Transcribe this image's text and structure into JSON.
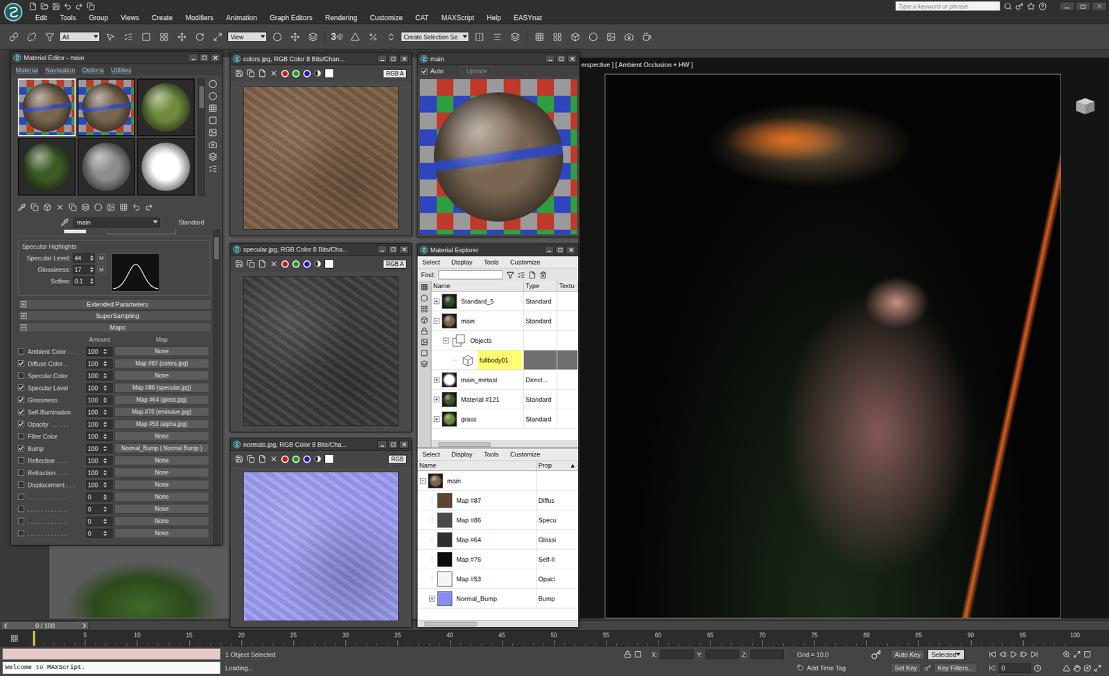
{
  "app": {
    "menu": [
      "Edit",
      "Tools",
      "Group",
      "Views",
      "Create",
      "Modifiers",
      "Animation",
      "Graph Editors",
      "Rendering",
      "Customize",
      "CAT",
      "MAXScript",
      "Help",
      "EASYnat"
    ],
    "search": {
      "placeholder": "Type a keyword or phrase"
    }
  },
  "toolbar": {
    "selection_filter": "All",
    "reference_coordinate_system": "View",
    "snap_toggle": "3",
    "named_selection_set": "Create Selection Se"
  },
  "viewport": {
    "label": "erspective ] [ Ambient Occlusion + HW ]"
  },
  "material_editor": {
    "title": "Material Editor - main",
    "menu": [
      "Material",
      "Navigation",
      "Options",
      "Utilities"
    ],
    "slots": [
      {
        "color": "#7a6650",
        "checker": true,
        "selected": true
      },
      {
        "color": "#7a6650",
        "checker": true,
        "selected": false
      },
      {
        "color": "#6f8a3c",
        "checker": false,
        "selected": false
      },
      {
        "color": "#3d5a26",
        "checker": false,
        "selected": false
      },
      {
        "color": "#8c8c8c",
        "checker": false,
        "selected": false
      },
      {
        "color": "#ffffff",
        "checker": false,
        "selected": false
      }
    ],
    "material_name": "main",
    "material_type": "Standard",
    "specular_highlights": {
      "title": "Specular Highlights",
      "params": [
        {
          "label": "Specular Level:",
          "value": "44",
          "map_button": "M"
        },
        {
          "label": "Glossiness:",
          "value": "17",
          "map_button": "M"
        },
        {
          "label": "Soften:",
          "value": "0.1"
        }
      ]
    },
    "rollouts": [
      {
        "label": "Extended Parameters",
        "expanded": false
      },
      {
        "label": "SuperSampling",
        "expanded": false
      },
      {
        "label": "Maps",
        "expanded": true
      }
    ],
    "maps": {
      "columns": [
        "Amount",
        "Map"
      ],
      "rows": [
        {
          "label": "Ambient Color . .",
          "checked": false,
          "amount": "100",
          "map": "None"
        },
        {
          "label": "Diffuse Color . .",
          "checked": true,
          "amount": "100",
          "map": "Map #87 (colors.jpg)"
        },
        {
          "label": "Specular Color",
          "checked": false,
          "amount": "100",
          "map": "None"
        },
        {
          "label": "Specular Level",
          "checked": true,
          "amount": "100",
          "map": "Map #86 (specular.jpg)"
        },
        {
          "label": "Glossiness",
          "checked": true,
          "amount": "100",
          "map": "Map #64 (gloss.jpg)"
        },
        {
          "label": "Self-Illumination",
          "checked": true,
          "amount": "100",
          "map": "Map #76 (emissive.jpg)"
        },
        {
          "label": "Opacity . . . . . .",
          "checked": true,
          "amount": "100",
          "map": "Map #53 (alpha.jpg)"
        },
        {
          "label": "Filter Color",
          "checked": false,
          "amount": "100",
          "map": "None"
        },
        {
          "label": "Bump",
          "checked": true,
          "amount": "100",
          "map": "Normal_Bump ( Normal Bump )"
        },
        {
          "label": "Reflection . . . .",
          "checked": false,
          "amount": "100",
          "map": "None"
        },
        {
          "label": "Refraction . . . .",
          "checked": false,
          "amount": "100",
          "map": "None"
        },
        {
          "label": "Displacement . . .",
          "checked": false,
          "amount": "100",
          "map": "None"
        },
        {
          "label": ". . . . . . . . . . . .",
          "checked": false,
          "amount": "0",
          "map": "None"
        },
        {
          "label": ". . . . . . . . . . . .",
          "checked": false,
          "amount": "0",
          "map": "None"
        },
        {
          "label": ". . . . . . . . . . . .",
          "checked": false,
          "amount": "0",
          "map": "None"
        },
        {
          "label": ". . . . . . . . . . . .",
          "checked": false,
          "amount": "0",
          "map": "None"
        }
      ]
    }
  },
  "bitmap_windows": [
    {
      "title": "colors.jpg, RGB Color 8 Bits/Chan...",
      "channel": "RGB A",
      "color": "#7a5e44"
    },
    {
      "title": "specular.jpg, RGB Color 8 Bits/Cha...",
      "channel": "RGB A",
      "color": "#3c3c3c"
    },
    {
      "title": "normals.jpg, RGB Color 8 Bits/Cha...",
      "channel": "RGB",
      "color": "#9d9cf2"
    }
  ],
  "preview_window": {
    "title": "main",
    "auto_label": "Auto",
    "auto": true,
    "update_label": "Update",
    "update_disabled": true
  },
  "material_explorer": {
    "title": "Material Explorer",
    "menu": [
      "Select",
      "Display",
      "Tools",
      "Customize"
    ],
    "find_label": "Find:",
    "columns": [
      "Name",
      "Type",
      "Textu"
    ],
    "rows": [
      {
        "name": "Standard_5",
        "type": "Standard",
        "depth": 0,
        "toggle": true,
        "expanded": false,
        "kind": "material",
        "color": "#2e4a28",
        "selected": false
      },
      {
        "name": "main",
        "type": "Standard",
        "depth": 0,
        "toggle": true,
        "expanded": true,
        "kind": "material",
        "color": "#7a6650",
        "selected": false
      },
      {
        "name": "Objects",
        "depth": 1,
        "toggle": true,
        "expanded": true,
        "kind": "group",
        "selected": false
      },
      {
        "name": "fullbody01",
        "depth": 2,
        "toggle": false,
        "expanded": false,
        "kind": "object",
        "selected": true
      },
      {
        "name": "main_metasl",
        "type": "Direct...",
        "depth": 0,
        "toggle": true,
        "expanded": false,
        "kind": "material",
        "color": "#ffffff",
        "selected": false
      },
      {
        "name": "Material #121",
        "type": "Standard",
        "depth": 0,
        "toggle": true,
        "expanded": false,
        "kind": "material",
        "color": "#3d5a26",
        "selected": false
      },
      {
        "name": "grass",
        "type": "Standard",
        "depth": 0,
        "toggle": true,
        "expanded": false,
        "kind": "material",
        "color": "#6f8a3c",
        "selected": false
      }
    ],
    "lower": {
      "menu": [
        "Select",
        "Display",
        "Tools",
        "Customize"
      ],
      "columns": [
        "Name",
        "Prop"
      ],
      "sort_indicator": "▲",
      "rows": [
        {
          "name": "main",
          "depth": 0,
          "toggle": true,
          "expanded": true,
          "kind": "material",
          "color": "#7a6650"
        },
        {
          "name": "Map #87",
          "prop": "Diffus",
          "depth": 1,
          "toggle": false,
          "expanded": false,
          "kind": "map",
          "color": "#5e4532"
        },
        {
          "name": "Map #86",
          "prop": "Specu",
          "depth": 1,
          "toggle": false,
          "expanded": false,
          "kind": "map",
          "color": "#4a4a4a"
        },
        {
          "name": "Map #64",
          "prop": "Glossi",
          "depth": 1,
          "toggle": false,
          "expanded": false,
          "kind": "map",
          "color": "#2e2e2e"
        },
        {
          "name": "Map #76",
          "prop": "Self-Il",
          "depth": 1,
          "toggle": false,
          "expanded": false,
          "kind": "map",
          "color": "#0c0c0c"
        },
        {
          "name": "Map #53",
          "prop": "Opaci",
          "depth": 1,
          "toggle": false,
          "expanded": false,
          "kind": "map",
          "color": "#f4f4f4"
        },
        {
          "name": "Normal_Bump",
          "prop": "Bump",
          "depth": 1,
          "toggle": true,
          "expanded": false,
          "kind": "map",
          "color": "#8c8cf0"
        }
      ]
    }
  },
  "timeline": {
    "position": "0 / 100",
    "level": 0,
    "ticks": [
      "5",
      "10",
      "15",
      "20",
      "25",
      "30",
      "35",
      "40",
      "45",
      "50",
      "55",
      "60",
      "65",
      "70",
      "75",
      "80",
      "85",
      "90",
      "95",
      "100"
    ]
  },
  "status_bar": {
    "listener_output": "Welcome to MAXScript.",
    "selection": "1 Object Selected",
    "prompt": "Loading...",
    "coords": [
      {
        "label": "X:"
      },
      {
        "label": "Y:"
      },
      {
        "label": "Z:"
      }
    ],
    "grid": "Grid = 10.0",
    "time_tag": "Add Time Tag",
    "auto_key": "Auto Key",
    "key_mode": "Selected",
    "set_key": "Set Key",
    "key_filters": "Key Filters...",
    "frame": "0"
  }
}
